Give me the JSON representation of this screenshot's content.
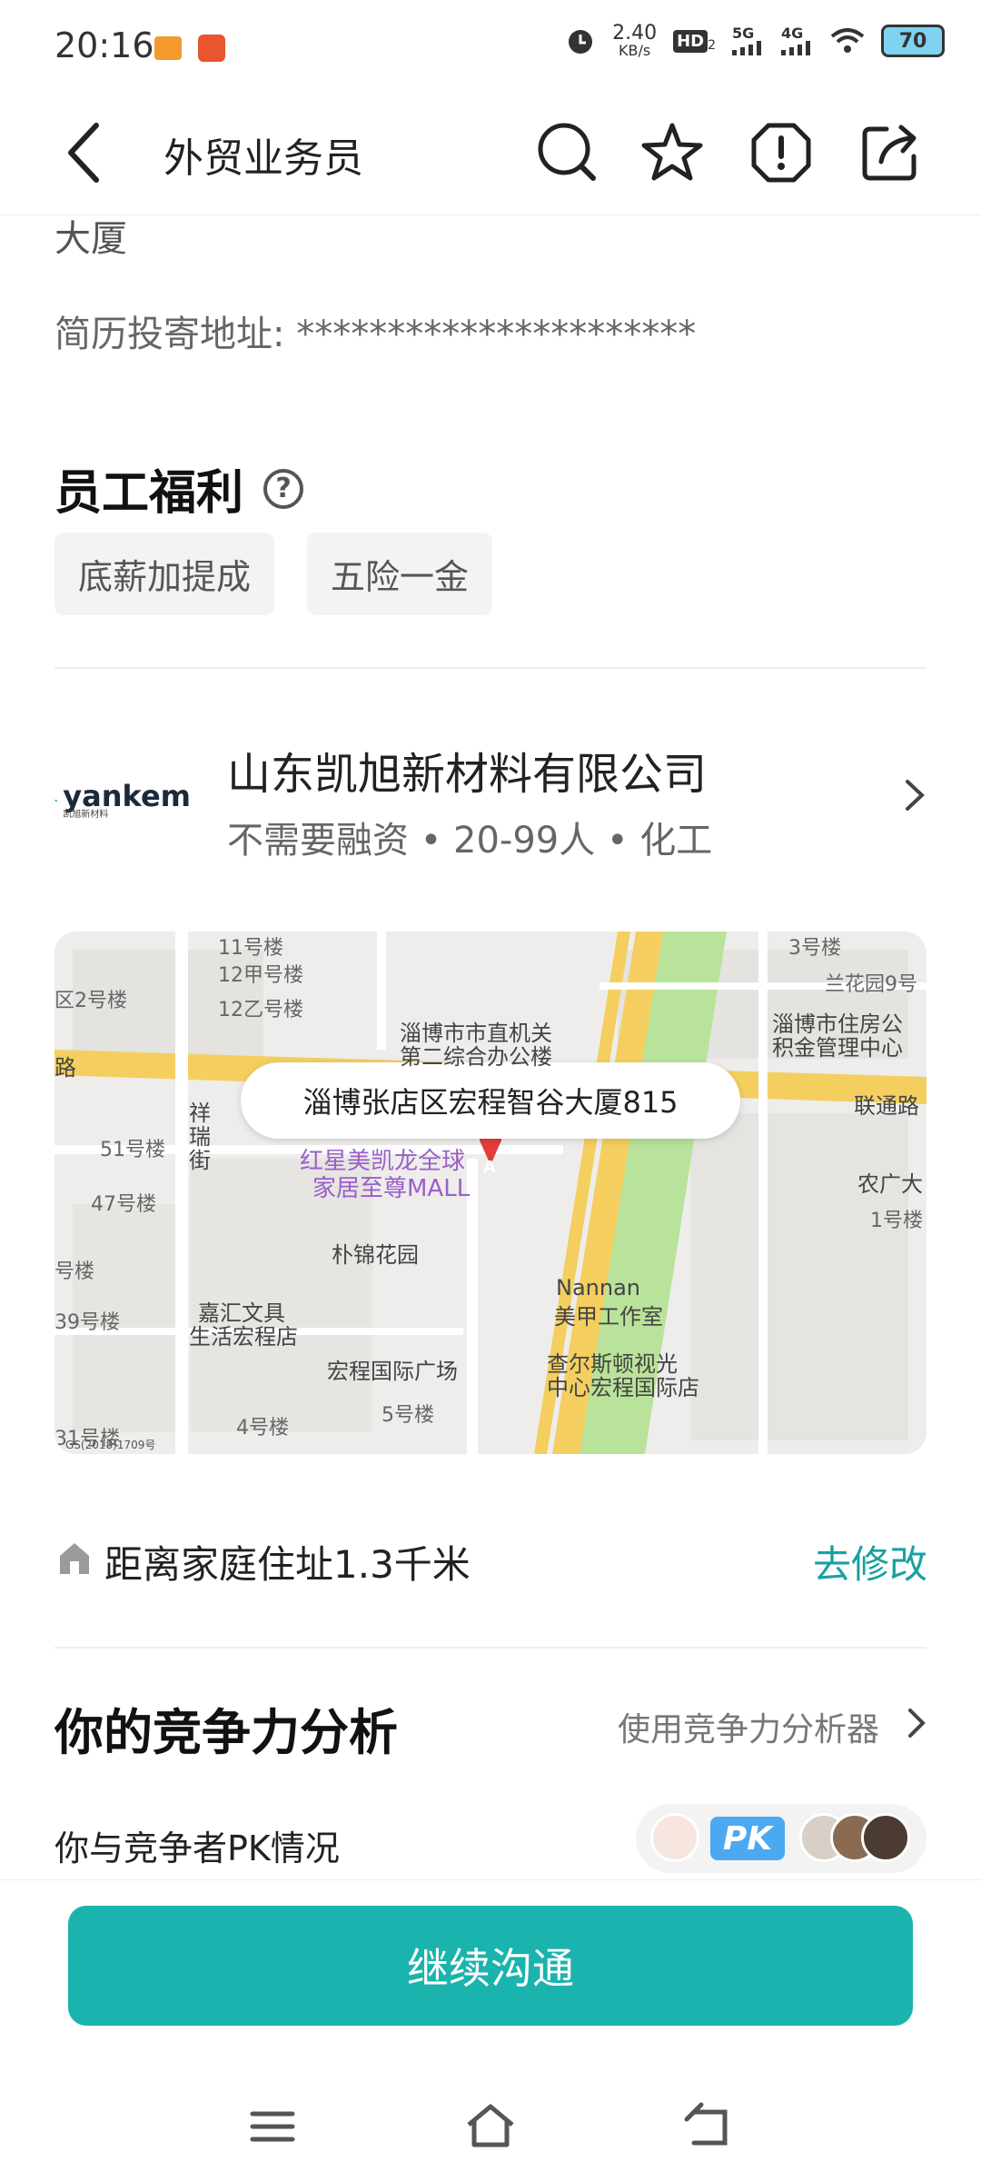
{
  "status_bar": {
    "time": "20:16",
    "net_speed": "2.40",
    "net_unit": "KB/s",
    "sim1": "5G",
    "sim2": "4G",
    "hd_label": "HD",
    "hd_sub": "2",
    "battery": "70"
  },
  "header": {
    "title": "外贸业务员"
  },
  "job": {
    "address_tail": "大厦",
    "resume_address_label": "简历投寄地址:",
    "resume_address_value": "**********************"
  },
  "benefits": {
    "title": "员工福利",
    "help_icon": "?",
    "tags": [
      "底薪加提成",
      "五险一金"
    ]
  },
  "company": {
    "logo_text": "yankem",
    "logo_sub": "凯旭新材料",
    "name": "山东凯旭新材料有限公司",
    "meta": "不需要融资 • 20-99人 • 化工"
  },
  "map": {
    "callout": "淄博张店区宏程智谷大厦815",
    "marker_letter": "A",
    "copyright": "GS(2018)1709号",
    "labels": {
      "l1": "12甲号楼",
      "l2": "12乙号楼",
      "l3": "区2号楼",
      "l4": "淄博市市直机关",
      "l5": "第二综合办公楼",
      "l6": "淄博市住房公",
      "l7": "积金管理中心",
      "l8": "兰花园9号",
      "l9": "3号楼",
      "l10": "联通路",
      "l11": "路",
      "l12": "祥",
      "l13": "瑞",
      "l14": "街",
      "l15": "51号楼",
      "l16": "47号楼",
      "l17": "红星美凯龙全球",
      "l18": "家居至尊MALL",
      "l19": "朴锦花园",
      "l20": "嘉汇文具",
      "l21": "生活宏程店",
      "l22": "宏程国际广场",
      "l23": "Nannan",
      "l24": "美甲工作室",
      "l25": "查尔斯顿视光",
      "l26": "中心宏程国际店",
      "l27": "农广大",
      "l28": "1号楼",
      "l29": "39号楼",
      "l30": "4号楼",
      "l31": "5号楼",
      "l32": "31号楼",
      "l33": "11号楼",
      "l34": "号楼"
    }
  },
  "distance": {
    "text": "距离家庭住址1.3千米",
    "edit": "去修改"
  },
  "competition": {
    "title": "你的竞争力分析",
    "tool_link": "使用竞争力分析器",
    "pk_label": "你与竞争者PK情况",
    "pk_badge": "PK"
  },
  "cta": {
    "label": "继续沟通"
  },
  "colors": {
    "accent": "#1bb3ad",
    "link": "#19a0a0",
    "map_green": "#b9e39a",
    "map_road": "#f4cf5f"
  }
}
